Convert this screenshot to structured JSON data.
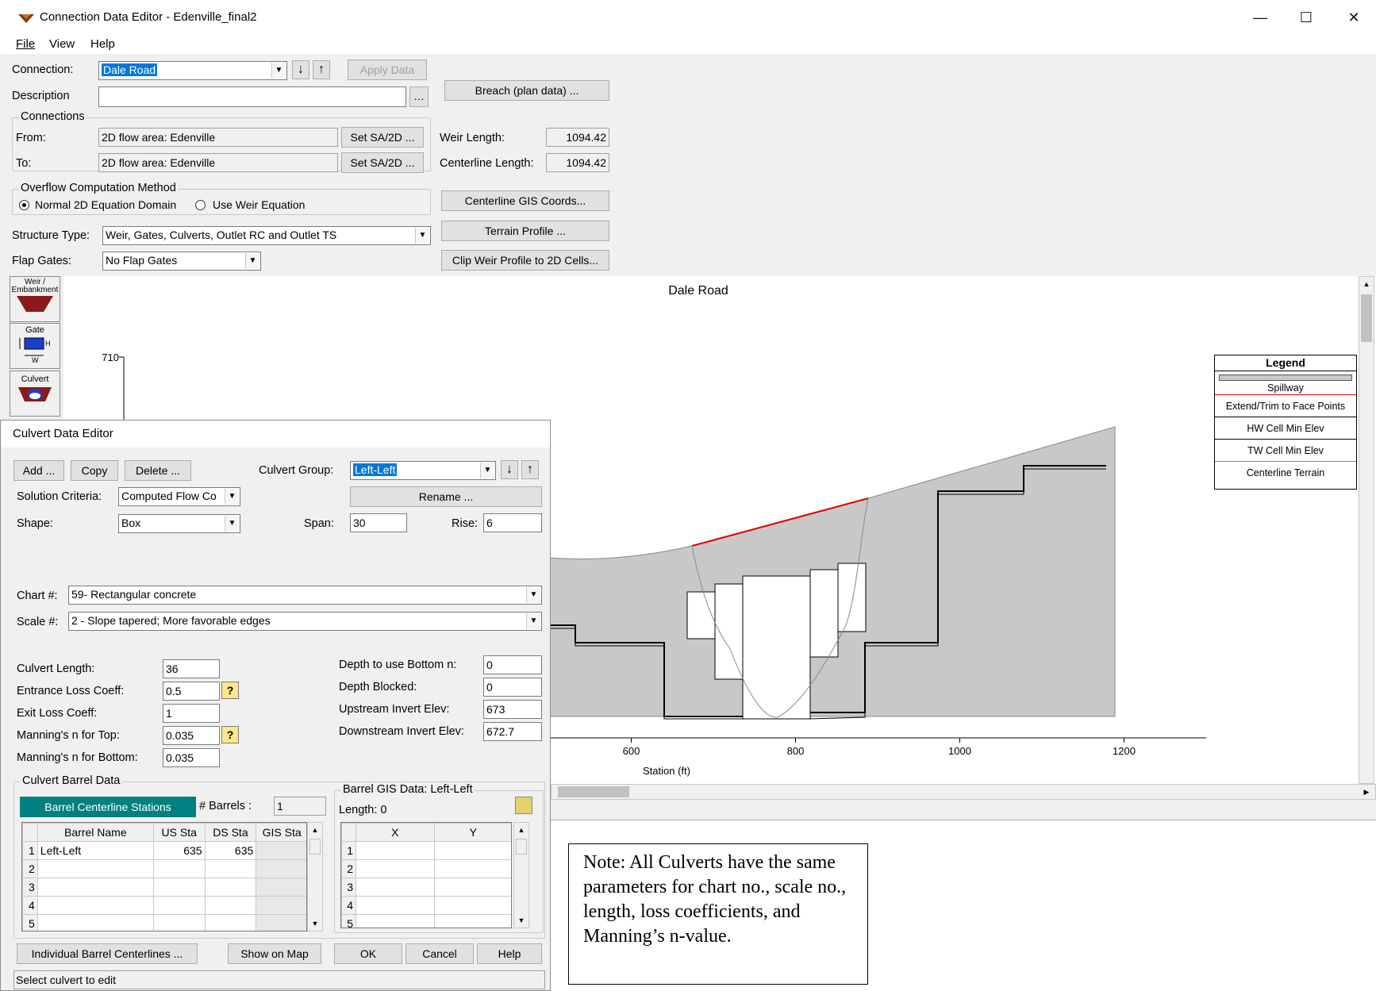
{
  "window": {
    "title": "Connection Data Editor - Edenville_final2",
    "min_glyph": "—",
    "max_glyph": "☐",
    "close_glyph": "✕"
  },
  "menu": [
    "File",
    "View",
    "Help"
  ],
  "connection": {
    "label": "Connection:",
    "value": "Dale Road",
    "apply_label": "Apply Data",
    "description_label": "Description",
    "description_value": "",
    "breach_label": "Breach (plan data) ..."
  },
  "connections_group": {
    "title": "Connections",
    "from_label": "From:",
    "from_value": "2D flow area: Edenville",
    "to_label": "To:",
    "to_value": "2D flow area: Edenville",
    "set_label": "Set SA/2D ...",
    "weir_length_label": "Weir Length:",
    "weir_length": "1094.42",
    "centerline_length_label": "Centerline Length:",
    "centerline_length": "1094.42"
  },
  "overflow": {
    "title": "Overflow Computation Method",
    "option1": "Normal 2D Equation Domain",
    "option2": "Use Weir Equation",
    "selected": 1
  },
  "buttons_right": {
    "centerline_gis": "Centerline GIS Coords...",
    "terrain_profile": "Terrain Profile ...",
    "clip_weir": "Clip Weir Profile to 2D Cells..."
  },
  "structure": {
    "type_label": "Structure Type:",
    "type_value": "Weir, Gates, Culverts, Outlet RC and Outlet TS",
    "flap_label": "Flap Gates:",
    "flap_value": "No Flap Gates"
  },
  "tools": {
    "weir": "Weir / Embankment",
    "gate": "Gate",
    "culvert": "Culvert"
  },
  "chart_data": {
    "type": "area",
    "title": "Dale Road",
    "xlabel": "Station (ft)",
    "ylabel": "",
    "x_ticks": [
      600,
      800,
      1000,
      1200
    ],
    "y_ticks": [
      710
    ],
    "legend_title": "Legend",
    "legend": [
      "Spillway",
      "Extend/Trim to Face Points",
      "HW Cell Min Elev",
      "TW Cell Min Elev",
      "Centerline Terrain"
    ]
  },
  "culvert_editor": {
    "title": "Culvert Data Editor",
    "add_label": "Add ...",
    "copy_label": "Copy",
    "delete_label": "Delete ...",
    "group_label": "Culvert Group:",
    "group_value": "Left-Left",
    "rename_label": "Rename ...",
    "solution_label": "Solution Criteria:",
    "solution_value": "Computed Flow Co",
    "shape_label": "Shape:",
    "shape_value": "Box",
    "span_label": "Span:",
    "span_value": "30",
    "rise_label": "Rise:",
    "rise_value": "6",
    "chart_label": "Chart #:",
    "chart_value": "59- Rectangular concrete",
    "scale_label": "Scale #:",
    "scale_value": "2 - Slope tapered; More favorable edges",
    "length_label": "Culvert Length:",
    "length_value": "36",
    "entrance_label": "Entrance Loss Coeff:",
    "entrance_value": "0.5",
    "exit_label": "Exit Loss Coeff:",
    "exit_value": "1",
    "n_top_label": "Manning's n for Top:",
    "n_top_value": "0.035",
    "n_bottom_label": "Manning's n for Bottom:",
    "n_bottom_value": "0.035",
    "depth_bottom_label": "Depth to use Bottom n:",
    "depth_bottom_value": "0",
    "depth_blocked_label": "Depth Blocked:",
    "depth_blocked_value": "0",
    "us_invert_label": "Upstream Invert Elev:",
    "us_invert_value": "673",
    "ds_invert_label": "Downstream Invert Elev:",
    "ds_invert_value": "672.7",
    "barrel_group_title": "Culvert Barrel Data",
    "barrel_tab": "Barrel Centerline Stations",
    "barrels_label": "# Barrels :",
    "barrels_value": "1",
    "columns": [
      "Barrel Name",
      "US Sta",
      "DS Sta",
      "GIS Sta"
    ],
    "rows": [
      {
        "n": "1",
        "name": "Left-Left",
        "us": "635",
        "ds": "635",
        "gis": ""
      },
      {
        "n": "2",
        "name": "",
        "us": "",
        "ds": "",
        "gis": ""
      },
      {
        "n": "3",
        "name": "",
        "us": "",
        "ds": "",
        "gis": ""
      },
      {
        "n": "4",
        "name": "",
        "us": "",
        "ds": "",
        "gis": ""
      },
      {
        "n": "5",
        "name": "",
        "us": "",
        "ds": "",
        "gis": ""
      }
    ],
    "gis_title": "Barrel GIS Data: Left-Left",
    "gis_length": "Length: 0",
    "gis_columns": [
      "X",
      "Y"
    ],
    "gis_rows": [
      "1",
      "2",
      "3",
      "4",
      "5"
    ],
    "individual_label": "Individual Barrel Centerlines ...",
    "show_map_label": "Show on Map",
    "ok_label": "OK",
    "cancel_label": "Cancel",
    "help_label": "Help",
    "status": "Select culvert to edit"
  },
  "note": "Note: All Culverts have the same parameters for chart no., scale no., length, loss coefficients, and Manning’s n-value."
}
